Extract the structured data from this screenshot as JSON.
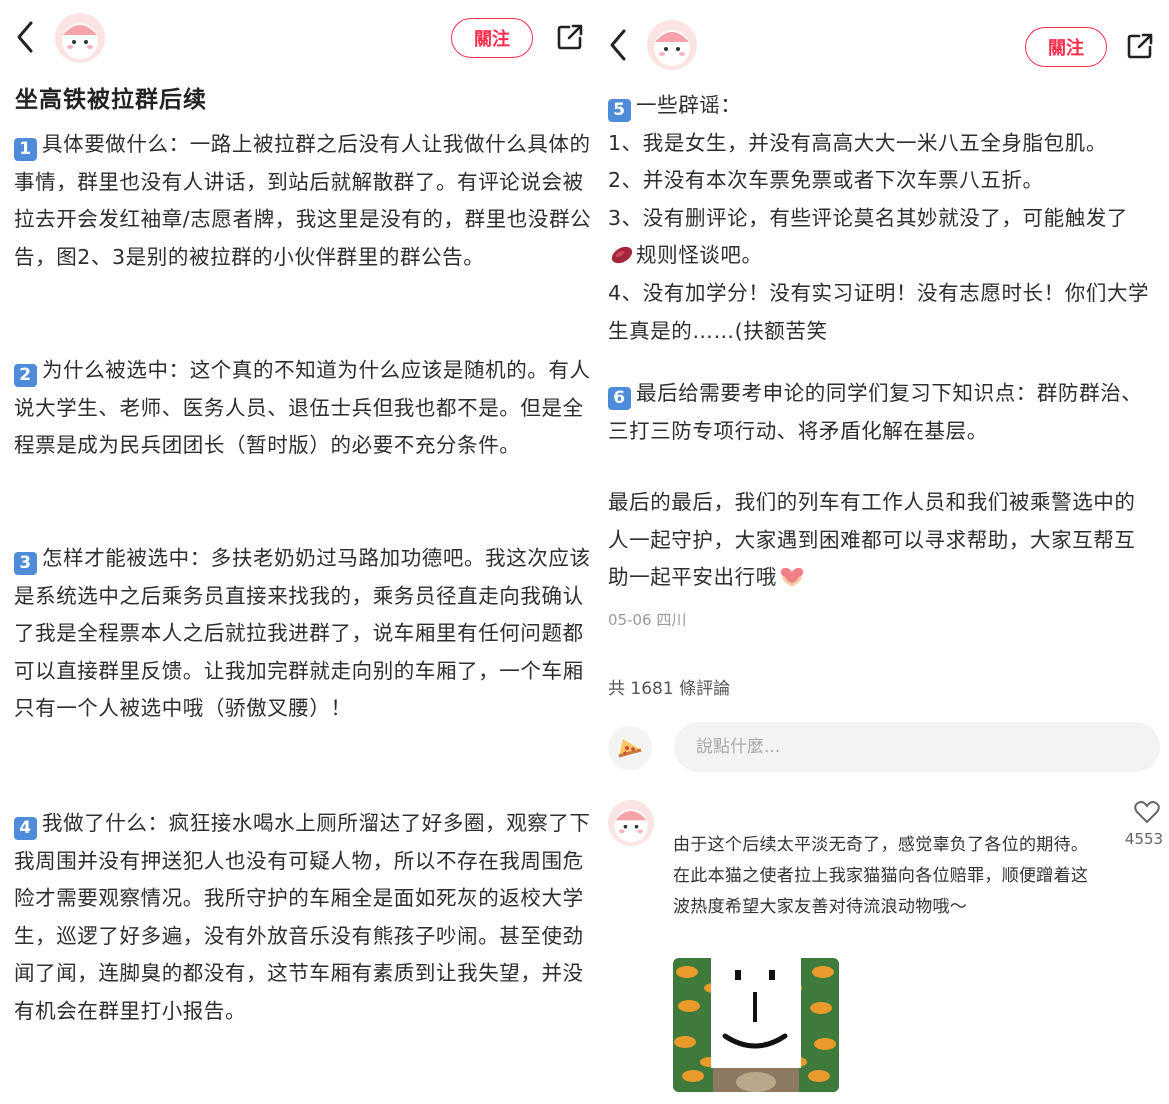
{
  "left": {
    "follow_label": "關注",
    "title": "坐高铁被拉群后续",
    "sections": [
      {
        "num": "1",
        "text": "具体要做什么：一路上被拉群之后没有人让我做什么具体的事情，群里也没有人讲话，到站后就解散群了。有评论说会被拉去开会发红袖章/志愿者牌，我这里是没有的，群里也没群公告，图2、3是别的被拉群的小伙伴群里的群公告。"
      },
      {
        "num": "2",
        "text": "为什么被选中：这个真的不知道为什么应该是随机的。有人说大学生、老师、医务人员、退伍士兵但我也都不是。但是全程票是成为民兵团团长（暂时版）的必要不充分条件。"
      },
      {
        "num": "3",
        "text": "怎样才能被选中：多扶老奶奶过马路加功德吧。我这次应该是系统选中之后乘务员直接来找我的，乘务员径直走向我确认了我是全程票本人之后就拉我进群了，说车厢里有任何问题都可以直接群里反馈。让我加完群就走向别的车厢了，一个车厢只有一个人被选中哦（骄傲叉腰）！"
      },
      {
        "num": "4",
        "text": "我做了什么：疯狂接水喝水上厕所溜达了好多圈，观察了下我周围并没有押送犯人也没有可疑人物，所以不存在我周围危险才需要观察情况。我所守护的车厢全是面如死灰的返校大学生，巡逻了好多遍，没有外放音乐没有熊孩子吵闹。甚至使劲闻了闻，连脚臭的都没有，这节车厢有素质到让我失望，并没有机会在群里打小报告。"
      }
    ]
  },
  "right": {
    "follow_label": "關注",
    "section5": {
      "num": "5",
      "heading": "一些辟谣：",
      "line1": "1、我是女生，并没有高高大大一米八五全身脂包肌。",
      "line2": "2、并没有本次车票免票或者下次车票八五折。",
      "line3a": "3、没有删评论，有些评论莫名其妙就没了，可能触发了",
      "line3b": "规则怪谈吧。",
      "line4": "4、没有加学分！没有实习证明！没有志愿时长！你们大学生真是的……(扶额苦笑"
    },
    "section6": {
      "num": "6",
      "text": "最后给需要考申论的同学们复习下知识点：群防群治、三打三防专项行动、将矛盾化解在基层。"
    },
    "closing": "最后的最后，我们的列车有工作人员和我们被乘警选中的人一起守护，大家遇到困难都可以寻求帮助，大家互帮互助一起平安出行哦",
    "date_location": "05-06 四川",
    "comment_count": "共 1681 條評論",
    "comment_placeholder": "說點什麼...",
    "comment": {
      "text": "由于这个后续太平淡无奇了，感觉辜负了各位的期待。在此本猫之使者拉上我家猫猫向各位赔罪，顺便蹭着这波热度希望大家友善对待流浪动物哦～",
      "likes": "4553"
    }
  },
  "colors": {
    "accent": "#ff2e4d",
    "number_badge": "#4e8bd8",
    "meta": "#999999"
  }
}
